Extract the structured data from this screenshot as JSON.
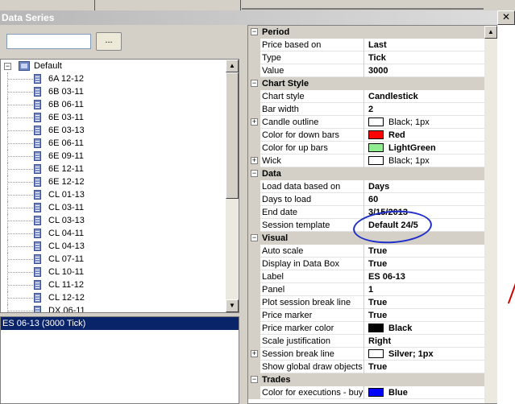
{
  "window": {
    "title": "Data Series",
    "close_glyph": "✕"
  },
  "search": {
    "value": "",
    "browse_label": "..."
  },
  "tree": {
    "root": {
      "label": "Default",
      "expander": "−"
    },
    "items": [
      "6A 12-12",
      "6B 03-11",
      "6B 06-11",
      "6E 03-11",
      "6E 03-13",
      "6E 06-11",
      "6E 09-11",
      "6E 12-11",
      "6E 12-12",
      "CL 01-13",
      "CL 03-11",
      "CL 03-13",
      "CL 04-11",
      "CL 04-13",
      "CL 07-11",
      "CL 10-11",
      "CL 11-12",
      "CL 12-12",
      "DX 06-11"
    ]
  },
  "selected_series": "ES 06-13 (3000 Tick)",
  "properties": [
    {
      "category": "Period",
      "expander": "−",
      "rows": [
        {
          "name": "Price based on",
          "value": "Last"
        },
        {
          "name": "Type",
          "value": "Tick"
        },
        {
          "name": "Value",
          "value": "3000"
        }
      ]
    },
    {
      "category": "Chart Style",
      "expander": "−",
      "rows": [
        {
          "name": "Chart style",
          "value": "Candlestick"
        },
        {
          "name": "Bar width",
          "value": "2"
        },
        {
          "name": "Candle outline",
          "value": "Black; 1px",
          "expander": "+",
          "swatch": "#ffffff",
          "normal": true
        },
        {
          "name": "Color for down bars",
          "value": "Red",
          "swatch": "#ff0000"
        },
        {
          "name": "Color for up bars",
          "value": "LightGreen",
          "swatch": "#90ee90"
        },
        {
          "name": "Wick",
          "value": "Black; 1px",
          "expander": "+",
          "swatch": "#ffffff",
          "normal": true
        }
      ]
    },
    {
      "category": "Data",
      "expander": "−",
      "rows": [
        {
          "name": "Load data based on",
          "value": "Days"
        },
        {
          "name": "Days to load",
          "value": "60"
        },
        {
          "name": "End date",
          "value": "3/15/2013"
        },
        {
          "name": "Session template",
          "value": "Default 24/5"
        }
      ]
    },
    {
      "category": "Visual",
      "expander": "−",
      "rows": [
        {
          "name": "Auto scale",
          "value": "True"
        },
        {
          "name": "Display in Data Box",
          "value": "True"
        },
        {
          "name": "Label",
          "value": "ES 06-13"
        },
        {
          "name": "Panel",
          "value": "1"
        },
        {
          "name": "Plot session break line",
          "value": "True"
        },
        {
          "name": "Price marker",
          "value": "True"
        },
        {
          "name": "Price marker color",
          "value": "Black",
          "swatch": "#000000"
        },
        {
          "name": "Scale justification",
          "value": "Right"
        },
        {
          "name": "Session break line",
          "value": "Silver; 1px",
          "expander": "+",
          "swatch": "#ffffff"
        },
        {
          "name": "Show global draw objects",
          "value": "True"
        }
      ]
    },
    {
      "category": "Trades",
      "expander": "−",
      "rows": [
        {
          "name": "Color for executions - buy",
          "value": "Blue",
          "swatch": "#0000ff"
        }
      ]
    }
  ]
}
